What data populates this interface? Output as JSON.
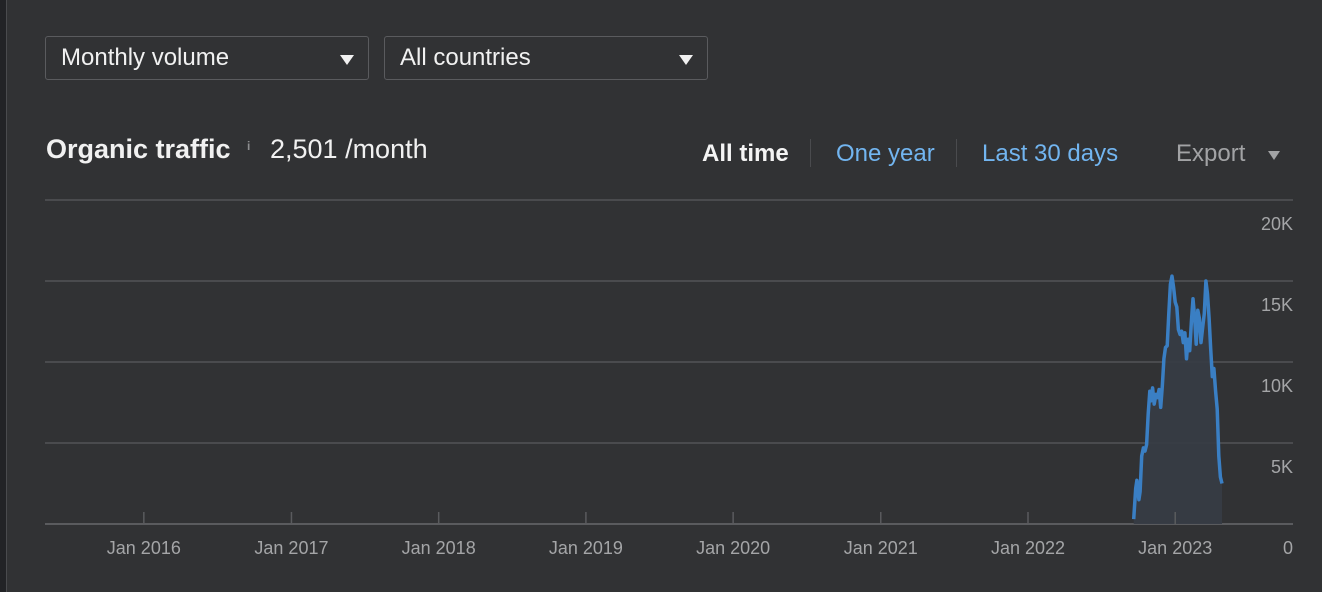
{
  "filters": {
    "metric_select": {
      "value": "Monthly volume"
    },
    "country_select": {
      "value": "All countries"
    }
  },
  "header": {
    "title": "Organic traffic",
    "info_icon": "i",
    "value": "2,501 /month"
  },
  "range_tabs": [
    {
      "label": "All time",
      "active": true
    },
    {
      "label": "One year",
      "active": false
    },
    {
      "label": "Last 30 days",
      "active": false
    }
  ],
  "export": {
    "label": "Export"
  },
  "colors": {
    "background": "#313234",
    "line": "#3a7fc4",
    "area": "#373c44",
    "link": "#72b5f0",
    "grid": "#4a4b4e"
  },
  "chart_data": {
    "type": "area",
    "title": "Organic traffic",
    "xlabel": "",
    "ylabel": "",
    "y_axis_position": "right",
    "ylim": [
      0,
      20000
    ],
    "xlim": [
      "2015-05-01",
      "2023-10-20"
    ],
    "grid": true,
    "y_ticks": [
      {
        "value": 20000,
        "label": "20K"
      },
      {
        "value": 15000,
        "label": "15K"
      },
      {
        "value": 10000,
        "label": "10K"
      },
      {
        "value": 5000,
        "label": "5K"
      },
      {
        "value": 0,
        "label": "0"
      }
    ],
    "x_ticks": [
      {
        "date": "2016-01-01",
        "label": "Jan 2016"
      },
      {
        "date": "2017-01-01",
        "label": "Jan 2017"
      },
      {
        "date": "2018-01-01",
        "label": "Jan 2018"
      },
      {
        "date": "2019-01-01",
        "label": "Jan 2019"
      },
      {
        "date": "2020-01-01",
        "label": "Jan 2020"
      },
      {
        "date": "2021-01-01",
        "label": "Jan 2021"
      },
      {
        "date": "2022-01-01",
        "label": "Jan 2022"
      },
      {
        "date": "2023-01-01",
        "label": "Jan 2023"
      }
    ],
    "series": [
      {
        "name": "Organic traffic",
        "points": [
          [
            "2022-09-20",
            300
          ],
          [
            "2022-09-25",
            2200
          ],
          [
            "2022-09-28",
            2700
          ],
          [
            "2022-10-03",
            1500
          ],
          [
            "2022-10-06",
            2000
          ],
          [
            "2022-10-10",
            4200
          ],
          [
            "2022-10-14",
            4700
          ],
          [
            "2022-10-18",
            4500
          ],
          [
            "2022-10-22",
            4900
          ],
          [
            "2022-10-26",
            6800
          ],
          [
            "2022-10-30",
            8200
          ],
          [
            "2022-11-02",
            7600
          ],
          [
            "2022-11-06",
            8400
          ],
          [
            "2022-11-10",
            7400
          ],
          [
            "2022-11-14",
            8000
          ],
          [
            "2022-11-18",
            7800
          ],
          [
            "2022-11-22",
            8300
          ],
          [
            "2022-11-26",
            7200
          ],
          [
            "2022-11-30",
            8500
          ],
          [
            "2022-12-04",
            10200
          ],
          [
            "2022-12-08",
            10900
          ],
          [
            "2022-12-12",
            11000
          ],
          [
            "2022-12-16",
            13000
          ],
          [
            "2022-12-20",
            14800
          ],
          [
            "2022-12-24",
            15300
          ],
          [
            "2022-12-28",
            14600
          ],
          [
            "2023-01-01",
            13700
          ],
          [
            "2023-01-05",
            13400
          ],
          [
            "2023-01-09",
            12000
          ],
          [
            "2023-01-13",
            11700
          ],
          [
            "2023-01-17",
            11900
          ],
          [
            "2023-01-21",
            11200
          ],
          [
            "2023-01-25",
            11800
          ],
          [
            "2023-01-29",
            10200
          ],
          [
            "2023-02-02",
            11400
          ],
          [
            "2023-02-06",
            10700
          ],
          [
            "2023-02-10",
            12500
          ],
          [
            "2023-02-14",
            13900
          ],
          [
            "2023-02-18",
            12800
          ],
          [
            "2023-02-22",
            11100
          ],
          [
            "2023-02-26",
            13200
          ],
          [
            "2023-03-02",
            12700
          ],
          [
            "2023-03-06",
            11200
          ],
          [
            "2023-03-10",
            12100
          ],
          [
            "2023-03-14",
            13000
          ],
          [
            "2023-03-18",
            15000
          ],
          [
            "2023-03-22",
            14200
          ],
          [
            "2023-03-26",
            12700
          ],
          [
            "2023-03-30",
            10800
          ],
          [
            "2023-04-03",
            9100
          ],
          [
            "2023-04-07",
            9600
          ],
          [
            "2023-04-11",
            8200
          ],
          [
            "2023-04-15",
            7100
          ],
          [
            "2023-04-19",
            4200
          ],
          [
            "2023-04-23",
            2900
          ],
          [
            "2023-04-27",
            2500
          ]
        ]
      }
    ]
  }
}
